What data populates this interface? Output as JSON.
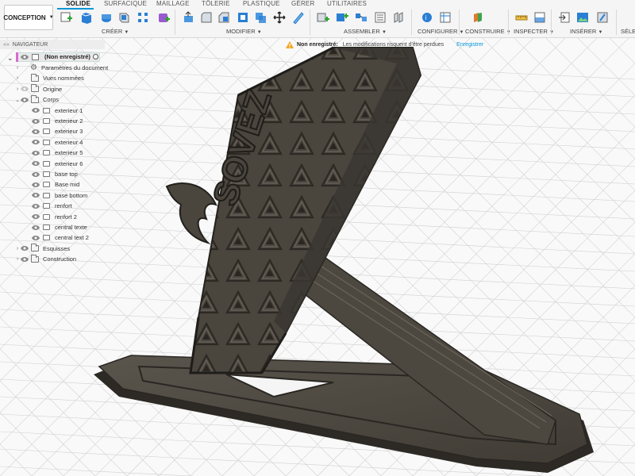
{
  "workspace": {
    "label": "CONCEPTION"
  },
  "tabs": [
    "SOLIDE",
    "SURFACIQUE",
    "MAILLAGE",
    "TÔLERIE",
    "PLASTIQUE",
    "GÉRER",
    "UTILITAIRES"
  ],
  "groups": [
    "CRÉER",
    "MODIFIER",
    "ASSEMBLER",
    "CONFIGURER",
    "CONSTRUIRE",
    "INSPECTER",
    "INSÉRER",
    "SÉLEC"
  ],
  "colors": {
    "accent": "#0696d7",
    "model": "#4f4a42",
    "warning": "#f5a623",
    "root_marker": "#d86bd1"
  },
  "navigator": {
    "title": "NAVIGATEUR",
    "root": "(Non enregistré)",
    "items": [
      "Paramètres du document",
      "Vues nommées",
      "Origine",
      "Corps"
    ],
    "bodies": [
      "exterieur 1",
      "exterieur 2",
      "exterieur 3",
      "exterieur 4",
      "exterieur 5",
      "exterieur 6",
      "base top",
      "Base mid",
      "base bottom",
      "renfort",
      "renfort 2",
      "central texte",
      "central text 2"
    ],
    "after": [
      "Esquisses",
      "Construction"
    ]
  },
  "notice": {
    "title": "Non enregistré:",
    "message": "Les modifications risquent d'être perdues",
    "action": "Enregistrer"
  },
  "model": {
    "text": "SOVEZ"
  }
}
